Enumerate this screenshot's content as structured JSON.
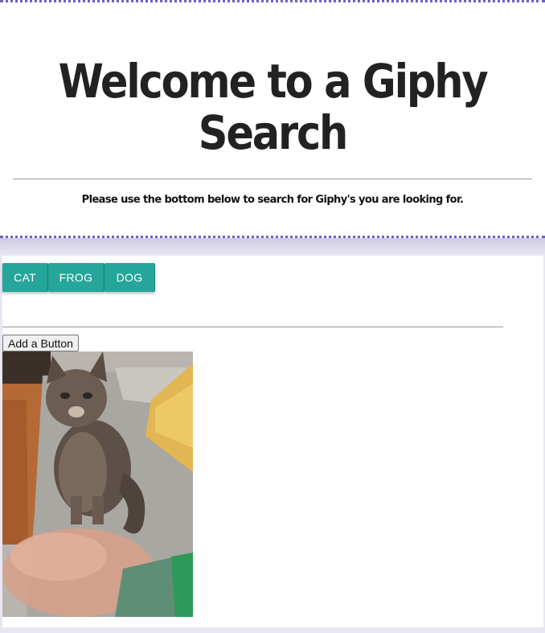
{
  "header": {
    "title": "Welcome to a Giphy Search",
    "subtitle": "Please use the bottom below to search for Giphy's you are looking for."
  },
  "topics": [
    "CAT",
    "FROG",
    "DOG"
  ],
  "controls": {
    "add_button_label": "Add a Button"
  },
  "colors": {
    "accent": "#26a69a",
    "header_border": "#6a60c8",
    "page_background": "#e9e6f3"
  },
  "gif": {
    "subject": "cat-gif"
  }
}
